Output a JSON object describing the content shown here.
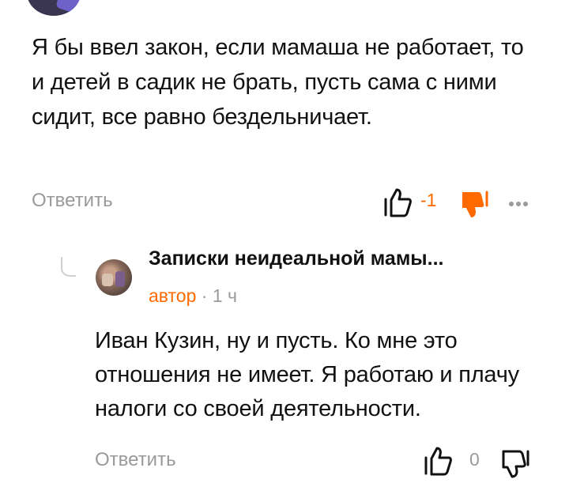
{
  "comment1": {
    "text": "Я бы ввел закон, если мамаша не работает, то и детей в садик не брать, пусть сама с ними сидит, все равно бездельничает.",
    "reply_label": "Ответить",
    "score": "-1",
    "like_icon": "thumb-up-outline",
    "dislike_icon": "thumb-down-filled",
    "more_icon": "ellipsis",
    "colors": {
      "score": "#ff6a00",
      "dislike": "#ff6a00",
      "muted": "#9a9a9a"
    }
  },
  "reply": {
    "author_name": "Записки неидеальной мамы...",
    "author_tag": "автор",
    "separator": "·",
    "time": "1 ч",
    "text": "Иван Кузин, ну и пусть. Ко мне это отношения не имеет. Я работаю и плачу налоги со своей деятельности.",
    "reply_label": "Ответить",
    "score": "0",
    "like_icon": "thumb-up-outline",
    "dislike_icon": "thumb-down-outline",
    "colors": {
      "author_tag": "#ff6a00",
      "muted": "#9a9a9a"
    }
  }
}
